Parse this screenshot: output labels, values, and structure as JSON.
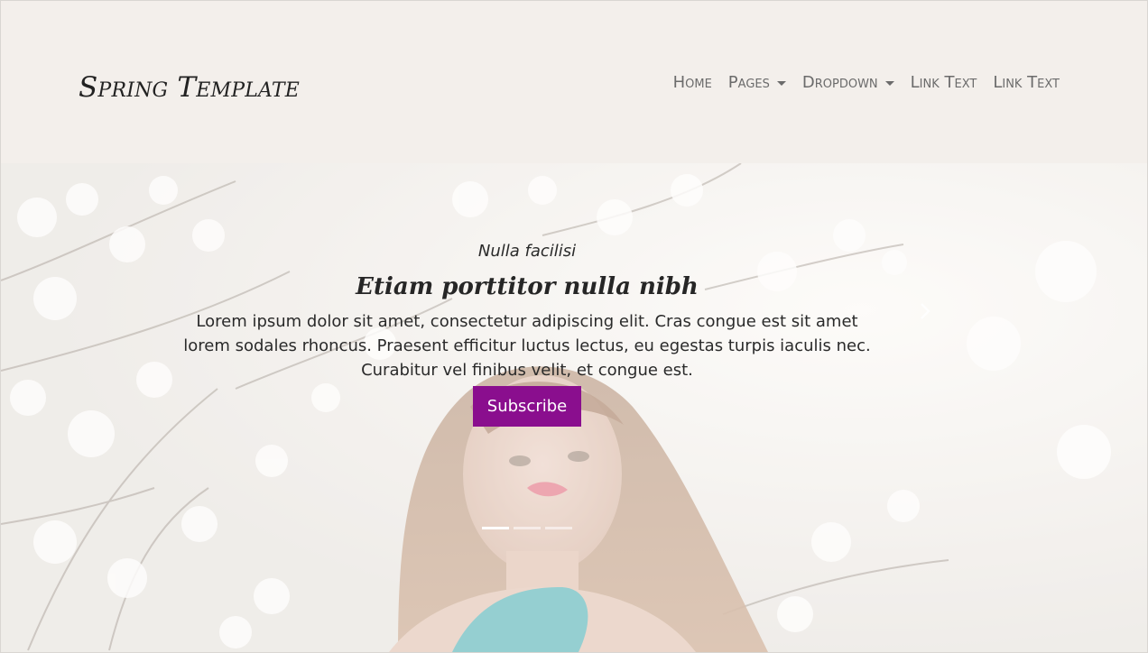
{
  "header": {
    "brand": "Spring Template",
    "nav": [
      {
        "label": "Home",
        "dropdown": false
      },
      {
        "label": "Pages",
        "dropdown": true
      },
      {
        "label": "Dropdown",
        "dropdown": true
      },
      {
        "label": "Link Text",
        "dropdown": false
      },
      {
        "label": "Link Text",
        "dropdown": false
      }
    ]
  },
  "hero": {
    "subtitle": "Nulla facilisi",
    "title": "Etiam porttitor nulla nibh",
    "body": "Lorem ipsum dolor sit amet, consectetur adipiscing elit. Cras congue est sit amet lorem sodales rhoncus. Praesent efficitur luctus lectus, eu egestas turpis iaculis nec. Curabitur vel finibus velit, et congue est.",
    "button_label": "Subscribe",
    "slides": 3,
    "active_slide": 1,
    "next_icon": "chevron-right-icon"
  },
  "colors": {
    "header_bg": "#f3efeb",
    "accent": "#8a0e8e",
    "nav_text": "#6b6b6b",
    "brand_text": "#222222"
  }
}
